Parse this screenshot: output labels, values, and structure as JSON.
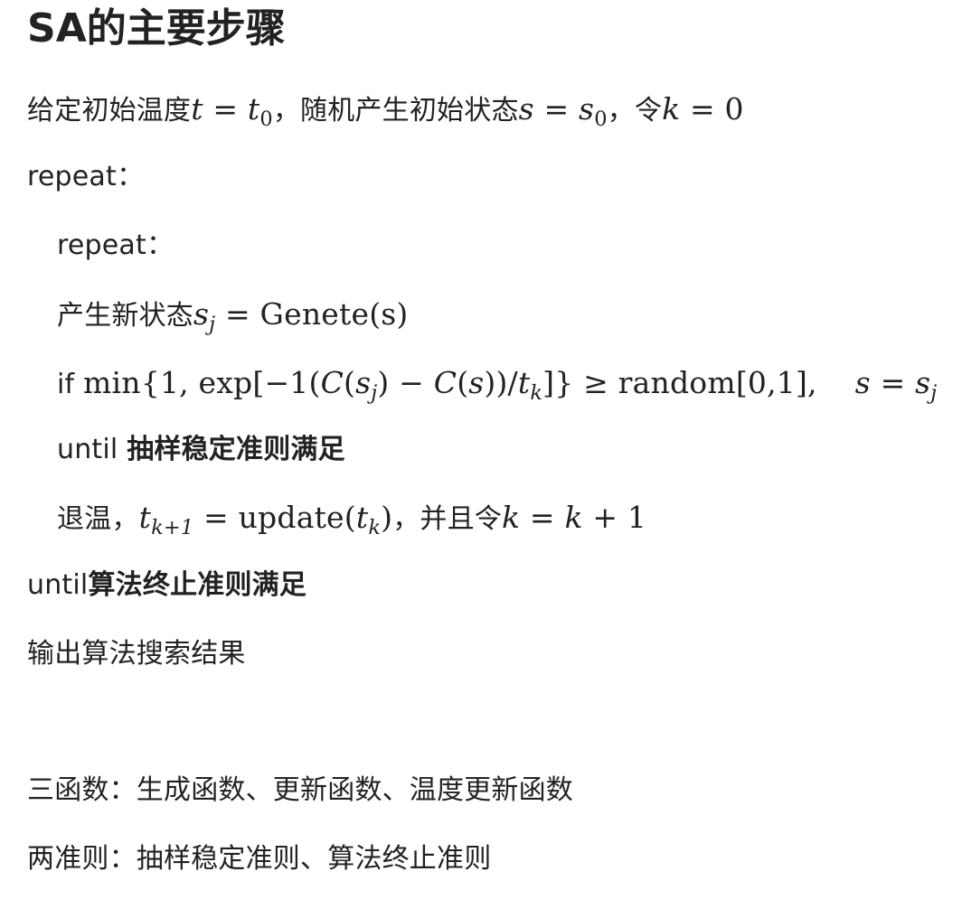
{
  "heading": "SA的主要步骤",
  "l1": {
    "a": "给定初始温度",
    "t": "t",
    "eq1": " = ",
    "t0": "t",
    "t0sub": "0",
    "b": "，随机产生初始状态",
    "s": "s",
    "eq2": " = ",
    "s0": "s",
    "s0sub": "0",
    "c": "，令",
    "k": "k",
    "eq3": " = 0"
  },
  "l2": "repeat：",
  "l3": "repeat：",
  "l4": {
    "a": "产生新状态",
    "s": "s",
    "ssub": "j",
    "rest": " = Genete(s)"
  },
  "l5": {
    "if": "if ",
    "p1": "min{1, exp[−1(",
    "C1": "C",
    "p2": "(",
    "s1": "s",
    "s1sub": "j",
    "p3": ") − ",
    "C2": "C",
    "p4": "(",
    "s2": "s",
    "p5": "))/",
    "t": "t",
    "tsub": "k",
    "p6": "]} ≥ random[0,1],",
    "s3": "s",
    "eq": " = ",
    "s4": "s",
    "s4sub": "j"
  },
  "l6": {
    "a": "until ",
    "b": "抽样稳定准则满足"
  },
  "l7": {
    "a": "退温，",
    "t": "t",
    "tsub": "k+1",
    "mid": " = update(",
    "t2": "t",
    "t2sub": "k",
    "close": ")",
    "b": "，并且令",
    "k": "k",
    "eq": " = ",
    "k2": "k",
    "plus": " + 1"
  },
  "l8": {
    "a": "until",
    "b": "算法终止准则满足"
  },
  "l9": "输出算法搜索结果",
  "l10": "三函数：生成函数、更新函数、温度更新函数",
  "l11": "两准则：抽样稳定准则、算法终止准则"
}
